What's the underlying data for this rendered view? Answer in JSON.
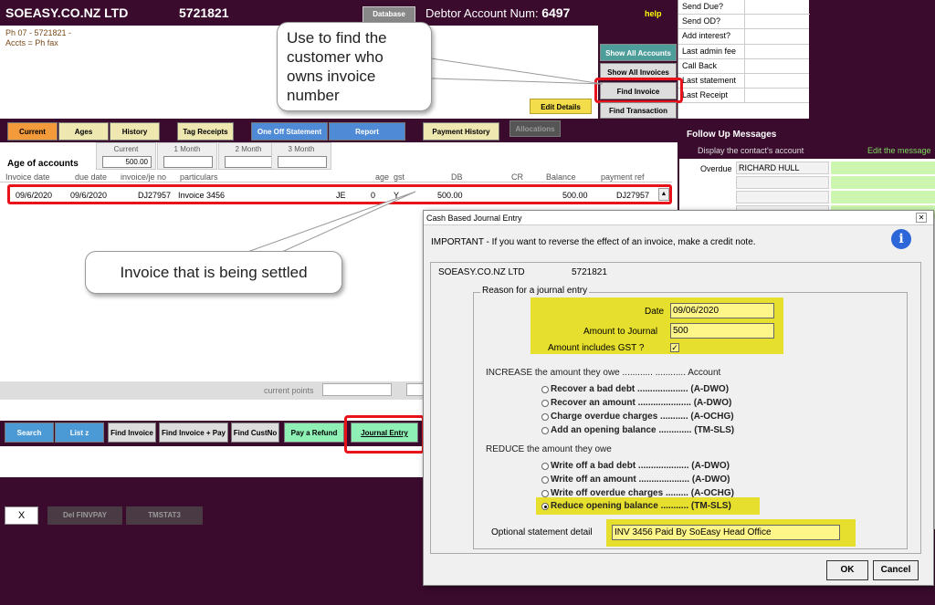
{
  "header": {
    "company": "SOEASY.CO.NZ LTD",
    "phone_code": "5721821",
    "database_btn": "Database",
    "debtor_label": "Debtor Account Num:",
    "debtor_num": "6497",
    "help": "help"
  },
  "checklist": [
    "Send Due?",
    "Send OD?",
    "Add interest?",
    "Last admin fee",
    "Call Back",
    "Last statement",
    "Last Receipt"
  ],
  "contact": {
    "line1": "Ph 07 - 5721821 -",
    "line2": "Accts =  Ph  fax"
  },
  "right_buttons": {
    "show_all_accounts": "Show All Accounts",
    "show_all_invoices": "Show All Invoices",
    "find_invoice": "Find Invoice",
    "find_transaction": "Find Transaction",
    "edit_details": "Edit Details"
  },
  "tabs": {
    "current": "Current",
    "ages": "Ages",
    "history": "History",
    "tag_receipts": "Tag Receipts",
    "one_off_statement": "One Off Statement",
    "report": "Report",
    "payment_history": "Payment History",
    "allocations": "Allocations"
  },
  "ages": {
    "label": "Age of accounts",
    "buckets": [
      {
        "label": "Current",
        "value": "500.00"
      },
      {
        "label": "1 Month",
        "value": ""
      },
      {
        "label": "2 Month",
        "value": ""
      },
      {
        "label": "3 Month",
        "value": ""
      }
    ]
  },
  "columns": [
    "Invoice date",
    "due date",
    "invoice/je no",
    "particulars",
    "age",
    "gst",
    "DB",
    "CR",
    "Balance",
    "payment ref"
  ],
  "invoice_row": {
    "invoice_date": "09/6/2020",
    "due_date": "09/6/2020",
    "invoice_no": "DJ27957",
    "particulars": "Invoice 3456",
    "type": "JE",
    "age": "0",
    "gst": "Y",
    "db": "500.00",
    "balance": "500.00",
    "payment_ref": "DJ27957"
  },
  "points_label": "current points",
  "bottom_buttons": {
    "search": "Search",
    "list_z": "List z",
    "find_invoice": "Find Invoice",
    "find_invoice_pay": "Find Invoice + Pay",
    "find_custno": "Find CustNo",
    "pay_refund": "Pay a Refund",
    "journal_entry": "Journal Entry"
  },
  "x_bar": {
    "x": "X",
    "del_finvpay": "Del FINVPAY",
    "tmstat3": "TMSTAT3"
  },
  "followup": {
    "title": "Follow Up Messages",
    "display_contact": "Display the contact's account",
    "edit_message": "Edit the message",
    "overdue_label": "Overdue",
    "overdue_name": "RICHARD HULL"
  },
  "callouts": {
    "find_owner": "Use to find the customer who owns invoice number",
    "settled": "Invoice that is being settled"
  },
  "dialog": {
    "title": "Cash Based Journal Entry",
    "important": "IMPORTANT - If you want to reverse the effect of an invoice, make a credit note.",
    "company": "SOEASY.CO.NZ LTD",
    "code": "5721821",
    "reason_title": "Reason for a journal entry",
    "date_label": "Date",
    "date_value": "09/06/2020",
    "amount_label": "Amount to Journal",
    "amount_value": "500",
    "gst_label": "Amount includes GST ?",
    "gst_check": "✓",
    "increase_title": "INCREASE the amount they owe ............ ............ Account",
    "increase_options": [
      "Recover a bad debt .................... (A-DWO)",
      "Recover an amount ..................... (A-DWO)",
      "Charge overdue charges ........... (A-OCHG)",
      "Add an opening balance ............. (TM-SLS)"
    ],
    "reduce_title": "REDUCE the amount they owe",
    "reduce_options": [
      "Write off a bad debt .................... (A-DWO)",
      "Write off an amount .................... (A-DWO)",
      "Write off overdue charges ......... (A-OCHG)",
      "Reduce opening balance ........... (TM-SLS)"
    ],
    "detail_label": "Optional statement detail",
    "detail_value": "INV 3456 Paid By SoEasy Head Office",
    "ok": "OK",
    "cancel": "Cancel"
  }
}
